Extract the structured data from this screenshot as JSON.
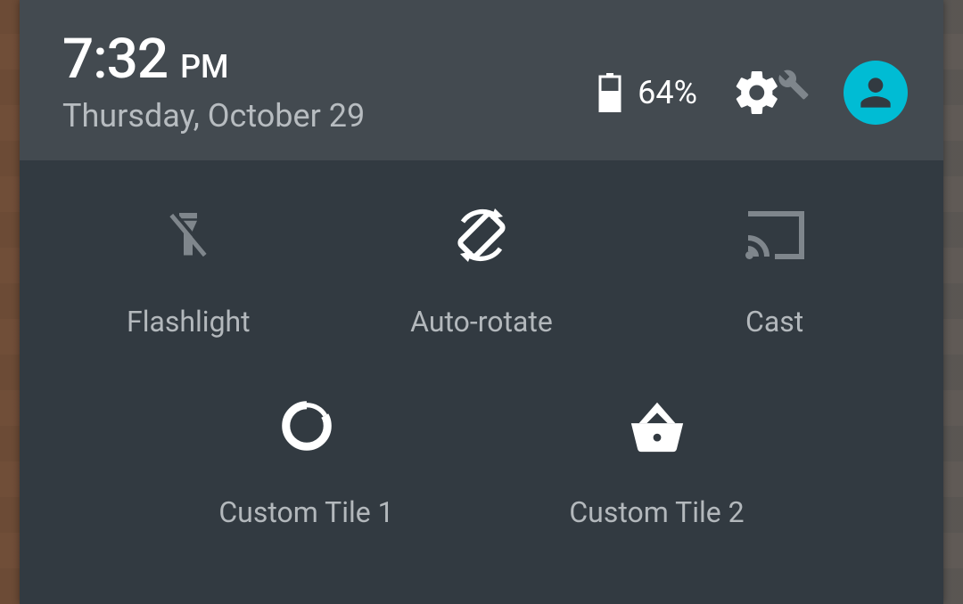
{
  "header": {
    "time": "7:32",
    "ampm": "PM",
    "date": "Thursday, October 29",
    "battery_pct": "64%"
  },
  "tiles": {
    "flashlight": "Flashlight",
    "autorotate": "Auto-rotate",
    "cast": "Cast",
    "custom1": "Custom Tile 1",
    "custom2": "Custom Tile 2"
  },
  "colors": {
    "header_bg": "#434a50",
    "tiles_bg": "#323a41",
    "accent": "#00BCD4",
    "label": "#b3b8bc"
  }
}
